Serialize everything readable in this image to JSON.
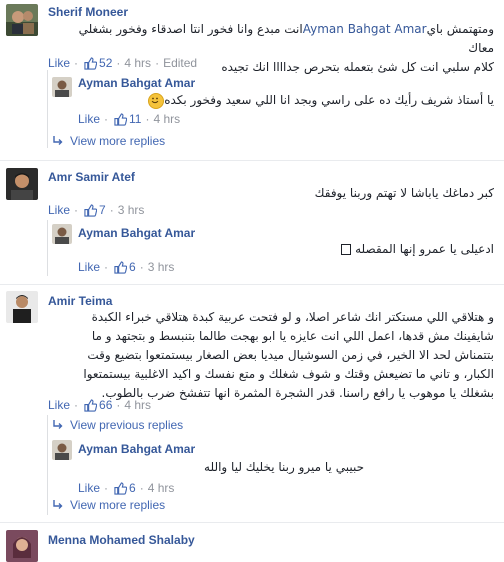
{
  "comments": [
    {
      "author": "Sherif Moneer",
      "text_line1_mention": "Ayman Bahgat Amar",
      "text_line1_rest": "انت مبدع وانا فخور انتا اصدقاء وفخور بشغلي معاك",
      "text_line1_end": " ومتهتمش باي",
      "text_line2": "كلام سلبي انت كل شئ بتعمله بتحرص جداااا انك تجيده",
      "like": "Like",
      "likes": "52",
      "time": "4 hrs",
      "edited": "Edited",
      "reply": {
        "author": "Ayman Bahgat Amar",
        "text": "يا أستاذ شريف رأيك ده على راسي وبجد انا اللي سعيد وفخور بكده",
        "like": "Like",
        "likes": "11",
        "time": "4 hrs"
      },
      "view_more": "View more replies"
    },
    {
      "author": "Amr Samir Atef",
      "text": "كبر دماغك ياباشا لا تهتم وربنا يوفقك",
      "like": "Like",
      "likes": "7",
      "time": "3 hrs",
      "reply": {
        "author": "Ayman Bahgat Amar",
        "text": "ادعيلى يا عمرو إنها المقصله",
        "like": "Like",
        "likes": "6",
        "time": "3 hrs"
      }
    },
    {
      "author": "Amir Teima",
      "lines": [
        "و هتلاقي اللي مستكتر انك شاعر اصلا، و لو فتحت عربية كبدة هتلاقي خبراء الكبدة",
        "شايفينك مش قدها، اعمل اللي انت عايزه يا ابو بهجت طالما بتنبسط و بتجتهد و ما",
        "بتتمناش لحد الا الخير، في زمن السوشيال ميديا بعض الصغار بيستمتعوا بتضيع وقت",
        "الكبار، و تاني ما تضيعش وقتك و شوف شغلك و متع نفسك و اكيد الاغلبية بيستمتعوا",
        "بشغلك يا موهوب يا رافع راسنا. قدر الشجرة المثمرة انها تتفشخ ضرب بالطوب."
      ],
      "like": "Like",
      "likes": "66",
      "time": "4 hrs",
      "view_previous": "View previous replies",
      "reply": {
        "author": "Ayman Bahgat Amar",
        "text": "حبيبي يا ميرو ربنا يخليك ليا والله",
        "like": "Like",
        "likes": "6",
        "time": "4 hrs"
      },
      "view_more": "View more replies"
    },
    {
      "author": "Menna Mohamed Shalaby"
    }
  ],
  "colors": {
    "link": "#365899",
    "action": "#4267b2",
    "meta": "#90949c",
    "text": "#1d2129"
  }
}
